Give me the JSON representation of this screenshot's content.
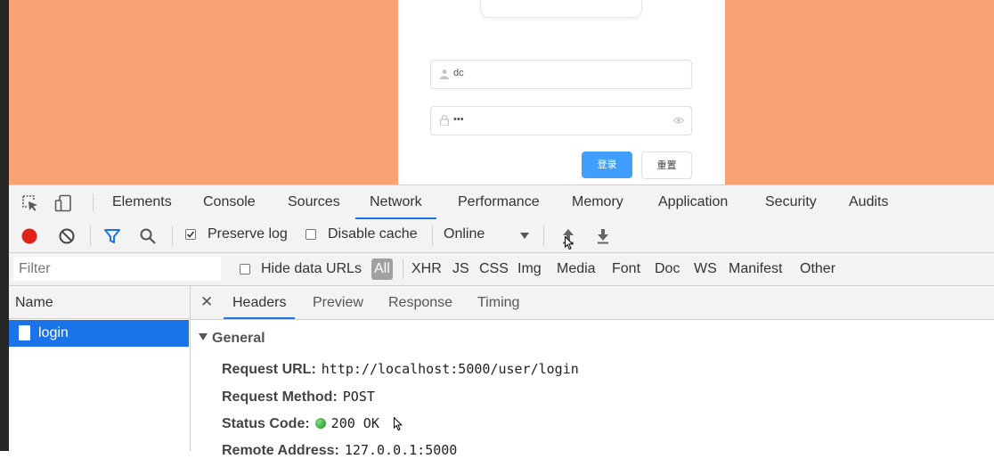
{
  "login_form": {
    "username_value": "dc",
    "password_mask": "•••",
    "login_button": "登录",
    "reset_button": "重置"
  },
  "devtools": {
    "panel_tabs": [
      "Elements",
      "Console",
      "Sources",
      "Network",
      "Performance",
      "Memory",
      "Application",
      "Security",
      "Audits"
    ],
    "active_panel": "Network",
    "controls": {
      "preserve_log": "Preserve log",
      "preserve_log_checked": true,
      "disable_cache": "Disable cache",
      "disable_cache_checked": false,
      "throttling": "Online"
    },
    "filter": {
      "placeholder": "Filter",
      "hide_data_urls": "Hide data URLs",
      "types": [
        "All",
        "XHR",
        "JS",
        "CSS",
        "Img",
        "Media",
        "Font",
        "Doc",
        "WS",
        "Manifest",
        "Other"
      ],
      "active_type": "All"
    },
    "name_column": "Name",
    "request": "login",
    "detail_tabs": [
      "Headers",
      "Preview",
      "Response",
      "Timing"
    ],
    "active_detail_tab": "Headers",
    "general": {
      "title": "General",
      "request_url_label": "Request URL:",
      "request_url": "http://localhost:5000/user/login",
      "request_method_label": "Request Method:",
      "request_method": "POST",
      "status_code_label": "Status Code:",
      "status_code": "200 OK",
      "remote_address_label": "Remote Address:",
      "remote_address": "127.0.0.1:5000"
    }
  },
  "colors": {
    "page_background": "#f9a374",
    "primary_button": "#409eff",
    "selection": "#1a73e8",
    "record": "#e0221b",
    "filter_icon": "#1a73e8",
    "status_ok": "#1c8c1c"
  }
}
